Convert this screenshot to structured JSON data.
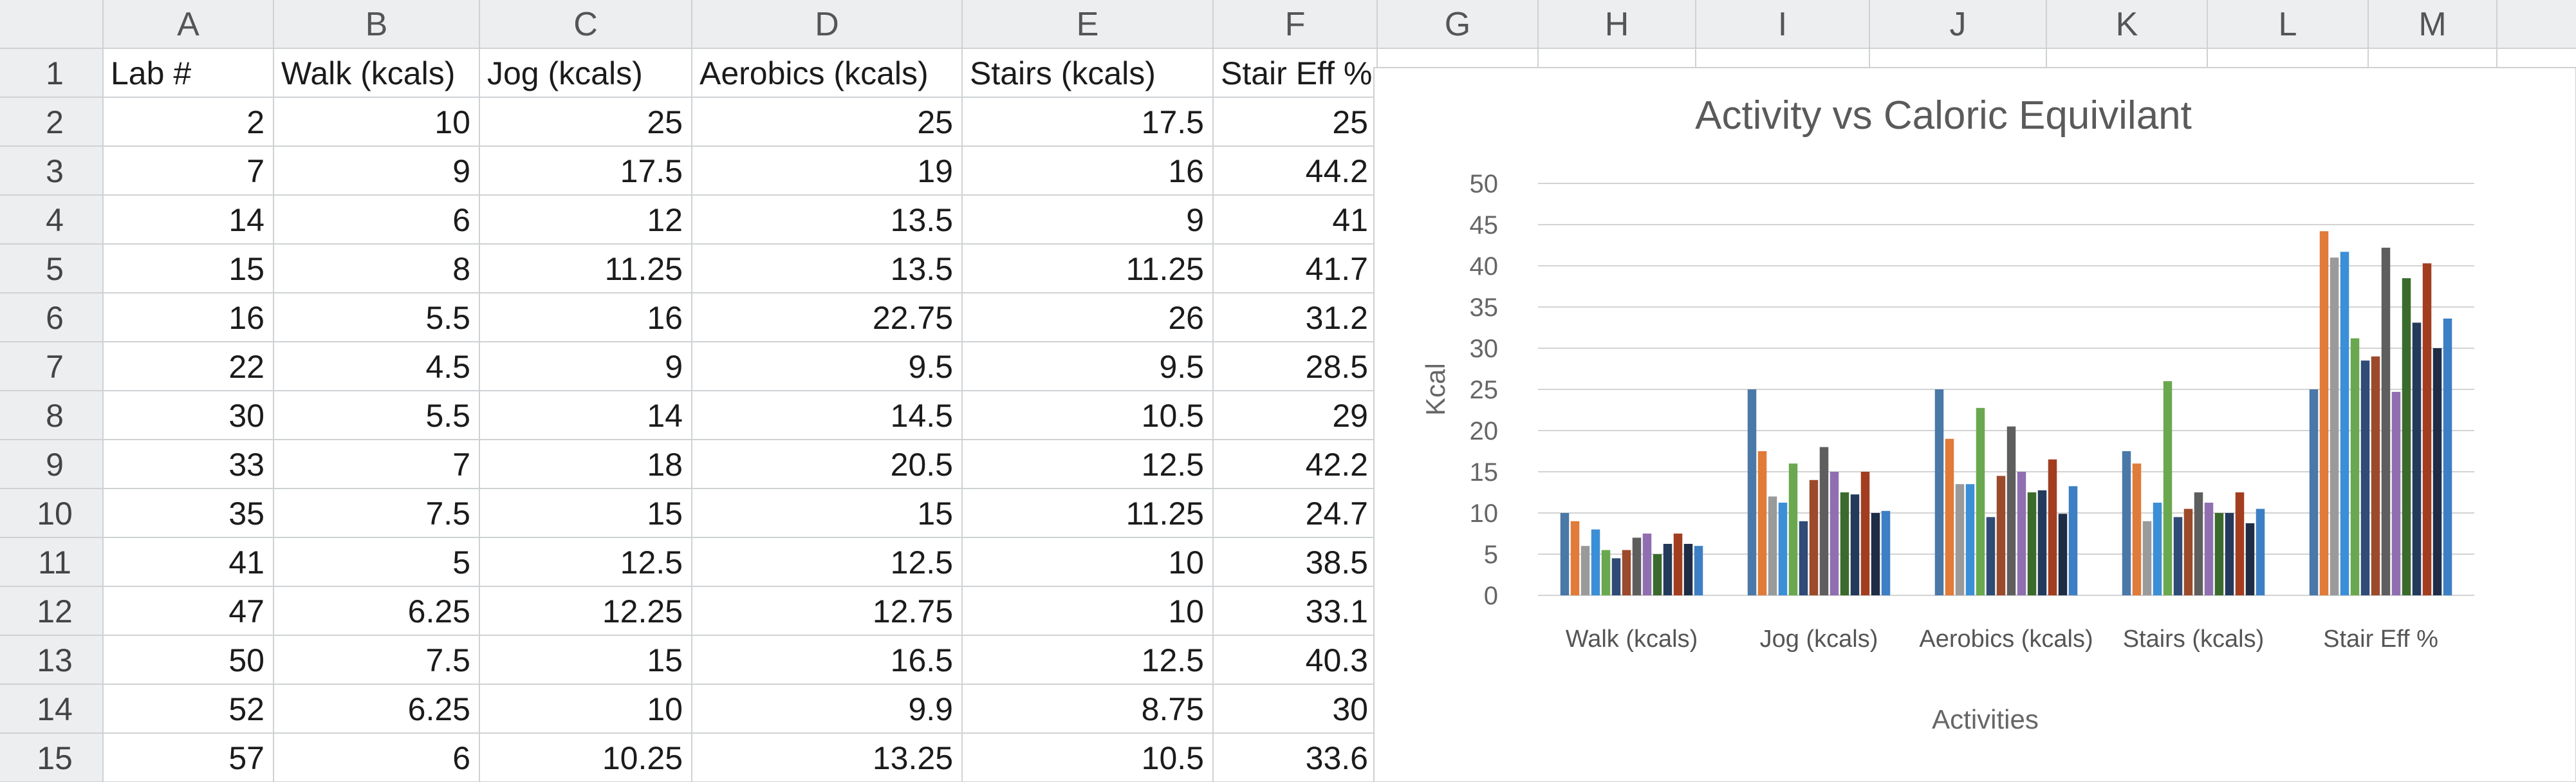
{
  "column_letters": [
    "A",
    "B",
    "C",
    "D",
    "E",
    "F",
    "G",
    "H",
    "I",
    "J",
    "K",
    "L",
    "M"
  ],
  "row_numbers": [
    "1",
    "2",
    "3",
    "4",
    "5",
    "6",
    "7",
    "8",
    "9",
    "10",
    "11",
    "12",
    "13",
    "14",
    "15"
  ],
  "headers": [
    "Lab #",
    "Walk (kcals)",
    "Jog (kcals)",
    "Aerobics (kcals)",
    "Stairs (kcals)",
    "Stair Eff %"
  ],
  "rows": [
    [
      "2",
      "10",
      "25",
      "25",
      "17.5",
      "25"
    ],
    [
      "7",
      "9",
      "17.5",
      "19",
      "16",
      "44.2"
    ],
    [
      "14",
      "6",
      "12",
      "13.5",
      "9",
      "41"
    ],
    [
      "15",
      "8",
      "11.25",
      "13.5",
      "11.25",
      "41.7"
    ],
    [
      "16",
      "5.5",
      "16",
      "22.75",
      "26",
      "31.2"
    ],
    [
      "22",
      "4.5",
      "9",
      "9.5",
      "9.5",
      "28.5"
    ],
    [
      "30",
      "5.5",
      "14",
      "14.5",
      "10.5",
      "29"
    ],
    [
      "33",
      "7",
      "18",
      "20.5",
      "12.5",
      "42.2"
    ],
    [
      "35",
      "7.5",
      "15",
      "15",
      "11.25",
      "24.7"
    ],
    [
      "41",
      "5",
      "12.5",
      "12.5",
      "10",
      "38.5"
    ],
    [
      "47",
      "6.25",
      "12.25",
      "12.75",
      "10",
      "33.1"
    ],
    [
      "50",
      "7.5",
      "15",
      "16.5",
      "12.5",
      "40.3"
    ],
    [
      "52",
      "6.25",
      "10",
      "9.9",
      "8.75",
      "30"
    ],
    [
      "57",
      "6",
      "10.25",
      "13.25",
      "10.5",
      "33.6"
    ]
  ],
  "colors": {
    "header_bg": "#eceeef",
    "cell_bg": "#ffffff",
    "series": [
      "#4a78a8",
      "#e07b39",
      "#9a9a9a",
      "#3b8fd6",
      "#6aa84f",
      "#2f4b76",
      "#9c4a2c",
      "#5e5e5e",
      "#8f6fb0",
      "#3a6b2c",
      "#233a5c",
      "#a23e1f",
      "#1e2d45",
      "#3d7fc4",
      "#e8935a"
    ]
  },
  "chart_data": {
    "type": "bar",
    "title": "Activity vs Caloric Equivilant",
    "xlabel": "Activities",
    "ylabel": "Kcal",
    "ylim": [
      0,
      50
    ],
    "yticks": [
      "0",
      "5",
      "10",
      "15",
      "20",
      "25",
      "30",
      "35",
      "40",
      "45",
      "50"
    ],
    "grid": true,
    "categories": [
      "Walk (kcals)",
      "Jog (kcals)",
      "Aerobics (kcals)",
      "Stairs (kcals)",
      "Stair Eff %"
    ],
    "series": [
      {
        "values": [
          10,
          25,
          25,
          17.5,
          25
        ]
      },
      {
        "values": [
          9,
          17.5,
          19,
          16,
          44.2
        ]
      },
      {
        "values": [
          6,
          12,
          13.5,
          9,
          41
        ]
      },
      {
        "values": [
          8,
          11.25,
          13.5,
          11.25,
          41.7
        ]
      },
      {
        "values": [
          5.5,
          16,
          22.75,
          26,
          31.2
        ]
      },
      {
        "values": [
          4.5,
          9,
          9.5,
          9.5,
          28.5
        ]
      },
      {
        "values": [
          5.5,
          14,
          14.5,
          10.5,
          29
        ]
      },
      {
        "values": [
          7,
          18,
          20.5,
          12.5,
          42.2
        ]
      },
      {
        "values": [
          7.5,
          15,
          15,
          11.25,
          24.7
        ]
      },
      {
        "values": [
          5,
          12.5,
          12.5,
          10,
          38.5
        ]
      },
      {
        "values": [
          6.25,
          12.25,
          12.75,
          10,
          33.1
        ]
      },
      {
        "values": [
          7.5,
          15,
          16.5,
          12.5,
          40.3
        ]
      },
      {
        "values": [
          6.25,
          10,
          9.9,
          8.75,
          30
        ]
      },
      {
        "values": [
          6,
          10.25,
          13.25,
          10.5,
          33.6
        ]
      }
    ]
  }
}
